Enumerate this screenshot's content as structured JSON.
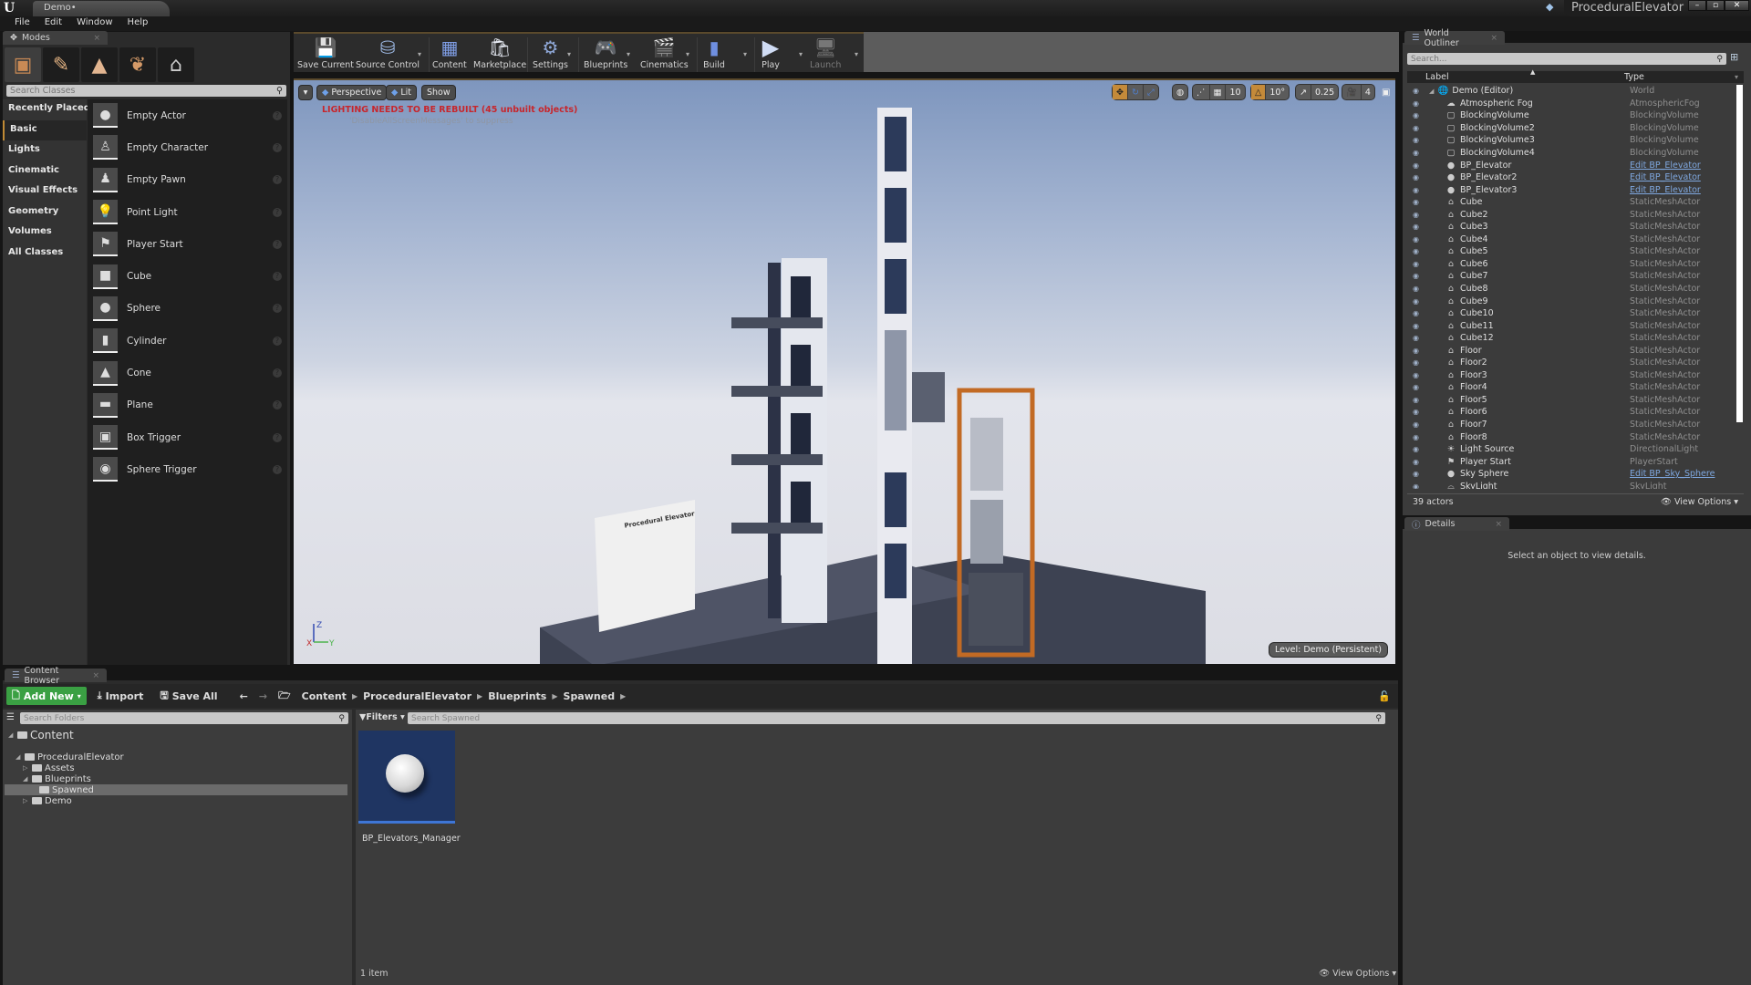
{
  "window": {
    "document_tab": "Demo•",
    "project_name": "ProceduralElevator",
    "controls": {
      "minimize": "–",
      "maximize": "▫",
      "close": "✕"
    }
  },
  "menu": [
    "File",
    "Edit",
    "Window",
    "Help"
  ],
  "modes": {
    "tab_label": "Modes",
    "mode_icons": [
      "place-mode-icon",
      "paint-mode-icon",
      "landscape-mode-icon",
      "foliage-mode-icon",
      "geometry-mode-icon"
    ],
    "search_placeholder": "Search Classes",
    "categories": [
      "Recently Placed",
      "Basic",
      "Lights",
      "Cinematic",
      "Visual Effects",
      "Geometry",
      "Volumes",
      "All Classes"
    ],
    "selected_category": "Basic",
    "classes": [
      "Empty Actor",
      "Empty Character",
      "Empty Pawn",
      "Point Light",
      "Player Start",
      "Cube",
      "Sphere",
      "Cylinder",
      "Cone",
      "Plane",
      "Box Trigger",
      "Sphere Trigger"
    ]
  },
  "toolbar": {
    "buttons": [
      "Save Current",
      "Source Control",
      "Content",
      "Marketplace",
      "Settings",
      "Blueprints",
      "Cinematics",
      "Build",
      "Play",
      "Launch"
    ]
  },
  "viewport": {
    "view_mode": "Perspective",
    "lighting_mode": "Lit",
    "show_label": "Show",
    "warning": "LIGHTING NEEDS TO BE REBUILT (45 unbuilt objects)",
    "warning_hint": "'DisableAllScreenMessages' to suppress",
    "grid_snap": "10",
    "rotation_snap": "10°",
    "scale_snap": "0.25",
    "camera_speed": "4",
    "level_label": "Level:  Demo (Persistent)",
    "sign_title": "Procedural Elevator",
    "axis": {
      "z": "Z",
      "y": "Y",
      "x": "X"
    }
  },
  "outliner": {
    "tab_label": "World Outliner",
    "search_placeholder": "Search...",
    "col_label": "Label",
    "col_type": "Type",
    "rows": [
      {
        "label": "Demo (Editor)",
        "type": "World",
        "link": false,
        "icon": "world-icon"
      },
      {
        "label": "Atmospheric Fog",
        "type": "AtmosphericFog",
        "link": false,
        "icon": "fog-icon"
      },
      {
        "label": "BlockingVolume",
        "type": "BlockingVolume",
        "link": false,
        "icon": "volume-icon"
      },
      {
        "label": "BlockingVolume2",
        "type": "BlockingVolume",
        "link": false,
        "icon": "volume-icon"
      },
      {
        "label": "BlockingVolume3",
        "type": "BlockingVolume",
        "link": false,
        "icon": "volume-icon"
      },
      {
        "label": "BlockingVolume4",
        "type": "BlockingVolume",
        "link": false,
        "icon": "volume-icon"
      },
      {
        "label": "BP_Elevator",
        "type": "Edit BP_Elevator",
        "link": true,
        "icon": "blueprint-icon"
      },
      {
        "label": "BP_Elevator2",
        "type": "Edit BP_Elevator",
        "link": true,
        "icon": "blueprint-icon"
      },
      {
        "label": "BP_Elevator3",
        "type": "Edit BP_Elevator",
        "link": true,
        "icon": "blueprint-icon"
      },
      {
        "label": "Cube",
        "type": "StaticMeshActor",
        "link": false,
        "icon": "static-mesh-icon"
      },
      {
        "label": "Cube2",
        "type": "StaticMeshActor",
        "link": false,
        "icon": "static-mesh-icon"
      },
      {
        "label": "Cube3",
        "type": "StaticMeshActor",
        "link": false,
        "icon": "static-mesh-icon"
      },
      {
        "label": "Cube4",
        "type": "StaticMeshActor",
        "link": false,
        "icon": "static-mesh-icon"
      },
      {
        "label": "Cube5",
        "type": "StaticMeshActor",
        "link": false,
        "icon": "static-mesh-icon"
      },
      {
        "label": "Cube6",
        "type": "StaticMeshActor",
        "link": false,
        "icon": "static-mesh-icon"
      },
      {
        "label": "Cube7",
        "type": "StaticMeshActor",
        "link": false,
        "icon": "static-mesh-icon"
      },
      {
        "label": "Cube8",
        "type": "StaticMeshActor",
        "link": false,
        "icon": "static-mesh-icon"
      },
      {
        "label": "Cube9",
        "type": "StaticMeshActor",
        "link": false,
        "icon": "static-mesh-icon"
      },
      {
        "label": "Cube10",
        "type": "StaticMeshActor",
        "link": false,
        "icon": "static-mesh-icon"
      },
      {
        "label": "Cube11",
        "type": "StaticMeshActor",
        "link": false,
        "icon": "static-mesh-icon"
      },
      {
        "label": "Cube12",
        "type": "StaticMeshActor",
        "link": false,
        "icon": "static-mesh-icon"
      },
      {
        "label": "Floor",
        "type": "StaticMeshActor",
        "link": false,
        "icon": "static-mesh-icon"
      },
      {
        "label": "Floor2",
        "type": "StaticMeshActor",
        "link": false,
        "icon": "static-mesh-icon"
      },
      {
        "label": "Floor3",
        "type": "StaticMeshActor",
        "link": false,
        "icon": "static-mesh-icon"
      },
      {
        "label": "Floor4",
        "type": "StaticMeshActor",
        "link": false,
        "icon": "static-mesh-icon"
      },
      {
        "label": "Floor5",
        "type": "StaticMeshActor",
        "link": false,
        "icon": "static-mesh-icon"
      },
      {
        "label": "Floor6",
        "type": "StaticMeshActor",
        "link": false,
        "icon": "static-mesh-icon"
      },
      {
        "label": "Floor7",
        "type": "StaticMeshActor",
        "link": false,
        "icon": "static-mesh-icon"
      },
      {
        "label": "Floor8",
        "type": "StaticMeshActor",
        "link": false,
        "icon": "static-mesh-icon"
      },
      {
        "label": "Light Source",
        "type": "DirectionalLight",
        "link": false,
        "icon": "directional-light-icon"
      },
      {
        "label": "Player Start",
        "type": "PlayerStart",
        "link": false,
        "icon": "player-start-icon"
      },
      {
        "label": "Sky Sphere",
        "type": "Edit BP_Sky_Sphere",
        "link": true,
        "icon": "blueprint-icon"
      },
      {
        "label": "SkyLight",
        "type": "SkyLight",
        "link": false,
        "icon": "skylight-icon"
      }
    ],
    "actor_count": "39 actors",
    "view_options": "View Options"
  },
  "details": {
    "tab_label": "Details",
    "empty_message": "Select an object to view details."
  },
  "content_browser": {
    "tab_label": "Content Browser",
    "add_new": "Add New",
    "import": "Import",
    "save_all": "Save All",
    "breadcrumb": [
      "Content",
      "ProceduralElevator",
      "Blueprints",
      "Spawned"
    ],
    "folder_search_placeholder": "Search Folders",
    "filters_label": "Filters",
    "asset_search_placeholder": "Search Spawned",
    "folders": [
      {
        "label": "Content",
        "depth": 0,
        "arrow": "◢",
        "selected": false
      },
      {
        "label": "ProceduralElevator",
        "depth": 1,
        "arrow": "◢",
        "selected": false
      },
      {
        "label": "Assets",
        "depth": 2,
        "arrow": "▷",
        "selected": false
      },
      {
        "label": "Blueprints",
        "depth": 2,
        "arrow": "◢",
        "selected": false
      },
      {
        "label": "Spawned",
        "depth": 3,
        "arrow": "",
        "selected": true
      },
      {
        "label": "Demo",
        "depth": 2,
        "arrow": "▷",
        "selected": false
      }
    ],
    "assets": [
      {
        "name": "BP_Elevators_Manager"
      }
    ],
    "item_count": "1 item",
    "view_options": "View Options"
  }
}
